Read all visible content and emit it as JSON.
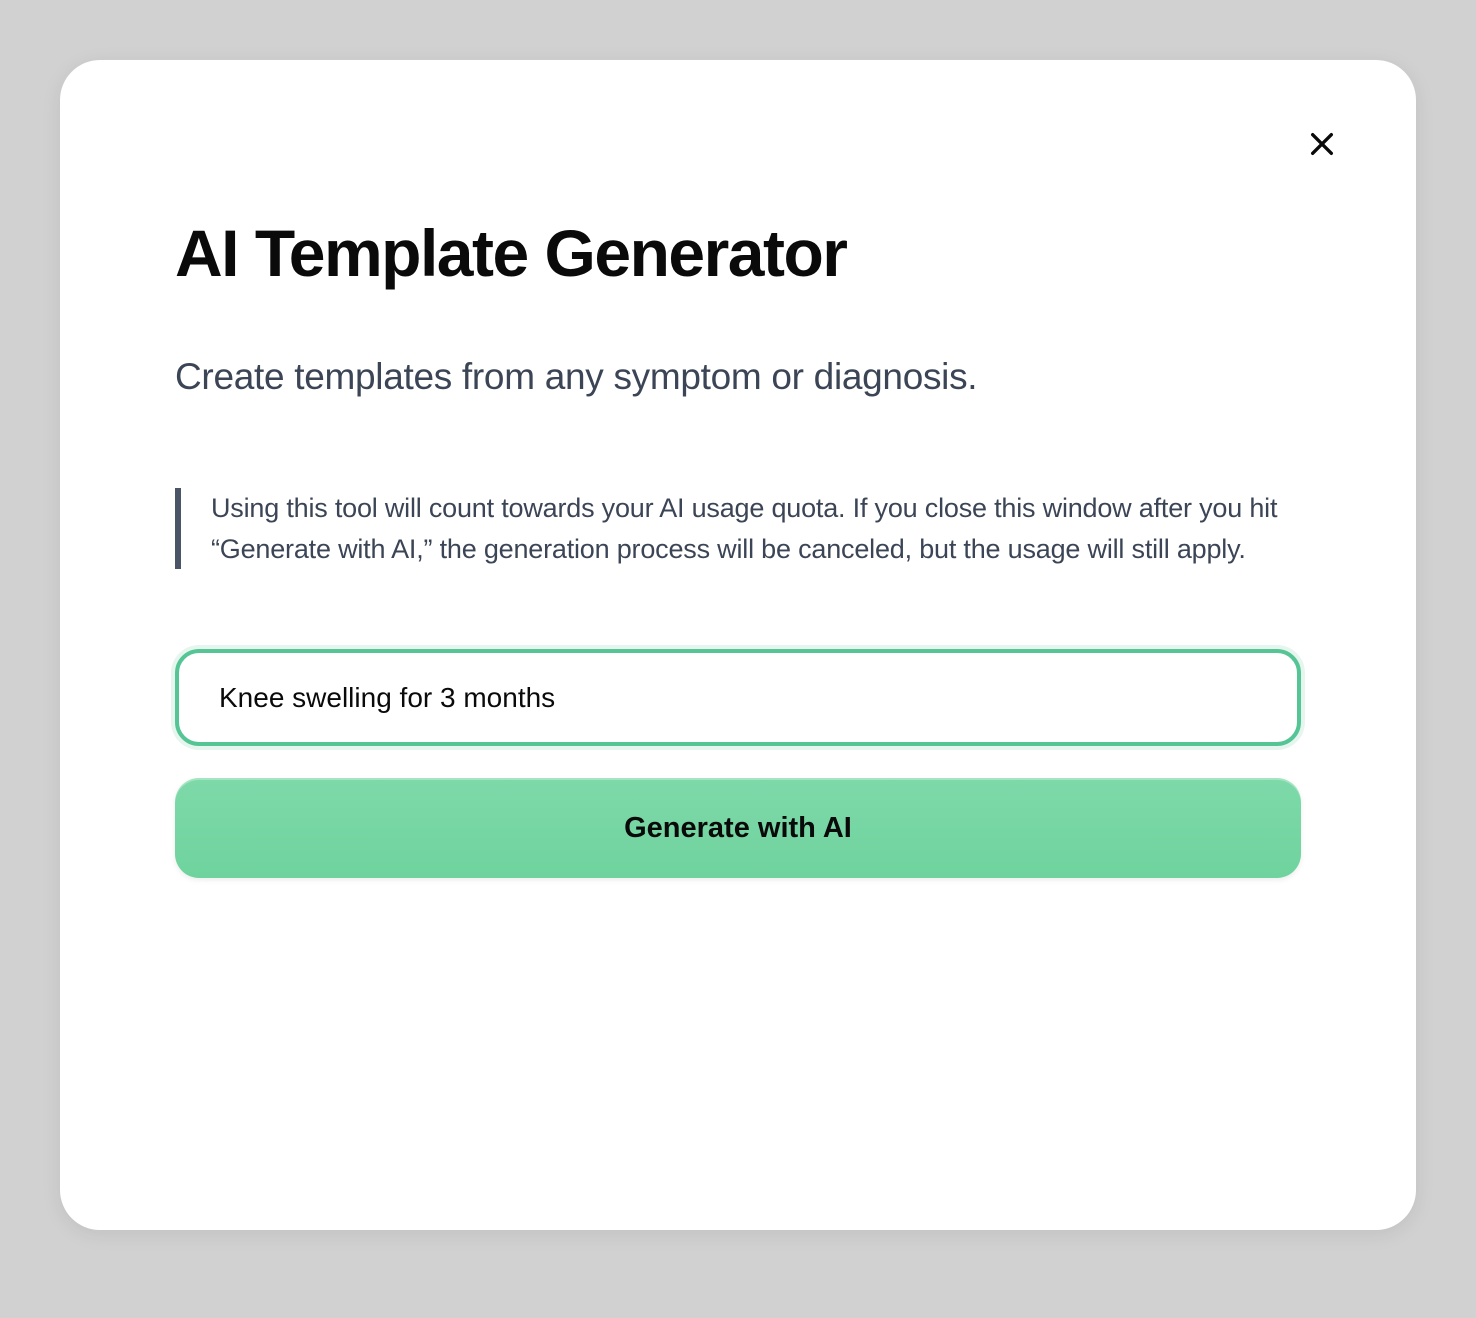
{
  "modal": {
    "title": "AI Template Generator",
    "subtitle": "Create templates from any symptom or diagnosis.",
    "note": "Using this tool will count towards your AI usage quota. If you close this window after you hit “Generate with AI,” the generation process will be canceled, but the usage will still apply.",
    "input": {
      "value": "Knee swelling for 3 months"
    },
    "generate_label": "Generate with AI"
  }
}
